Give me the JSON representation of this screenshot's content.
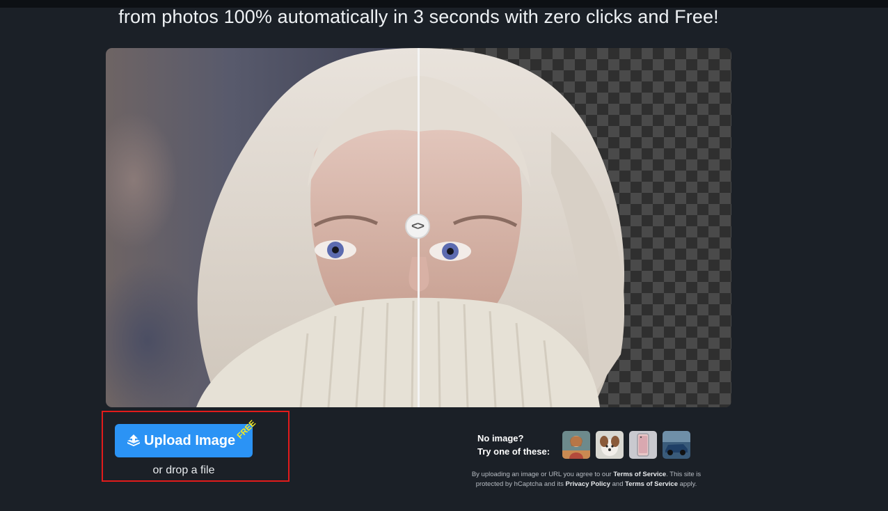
{
  "headline": "from photos 100% automatically in 3 seconds with zero clicks and Free!",
  "compare": {
    "handle_glyph": "<>"
  },
  "upload": {
    "button_label": "Upload Image",
    "badge": "FREE",
    "drop_text": "or drop a file",
    "icon": "upload-layers-icon"
  },
  "samples": {
    "line1": "No image?",
    "line2": "Try one of these:",
    "thumbs": [
      "sample-woman-thumb",
      "sample-dog-thumb",
      "sample-phone-thumb",
      "sample-car-thumb"
    ]
  },
  "legal": {
    "part1": "By uploading an image or URL you agree to our ",
    "terms1": "Terms of Service",
    "part2": ". This site is protected by hCaptcha and its ",
    "privacy": "Privacy Policy",
    "part3": " and ",
    "terms2": "Terms of Service",
    "part4": " apply."
  },
  "colors": {
    "background": "#1b2027",
    "button": "#2b93f5",
    "badge": "#f5ea24",
    "highlight_frame": "#e21b1b"
  }
}
